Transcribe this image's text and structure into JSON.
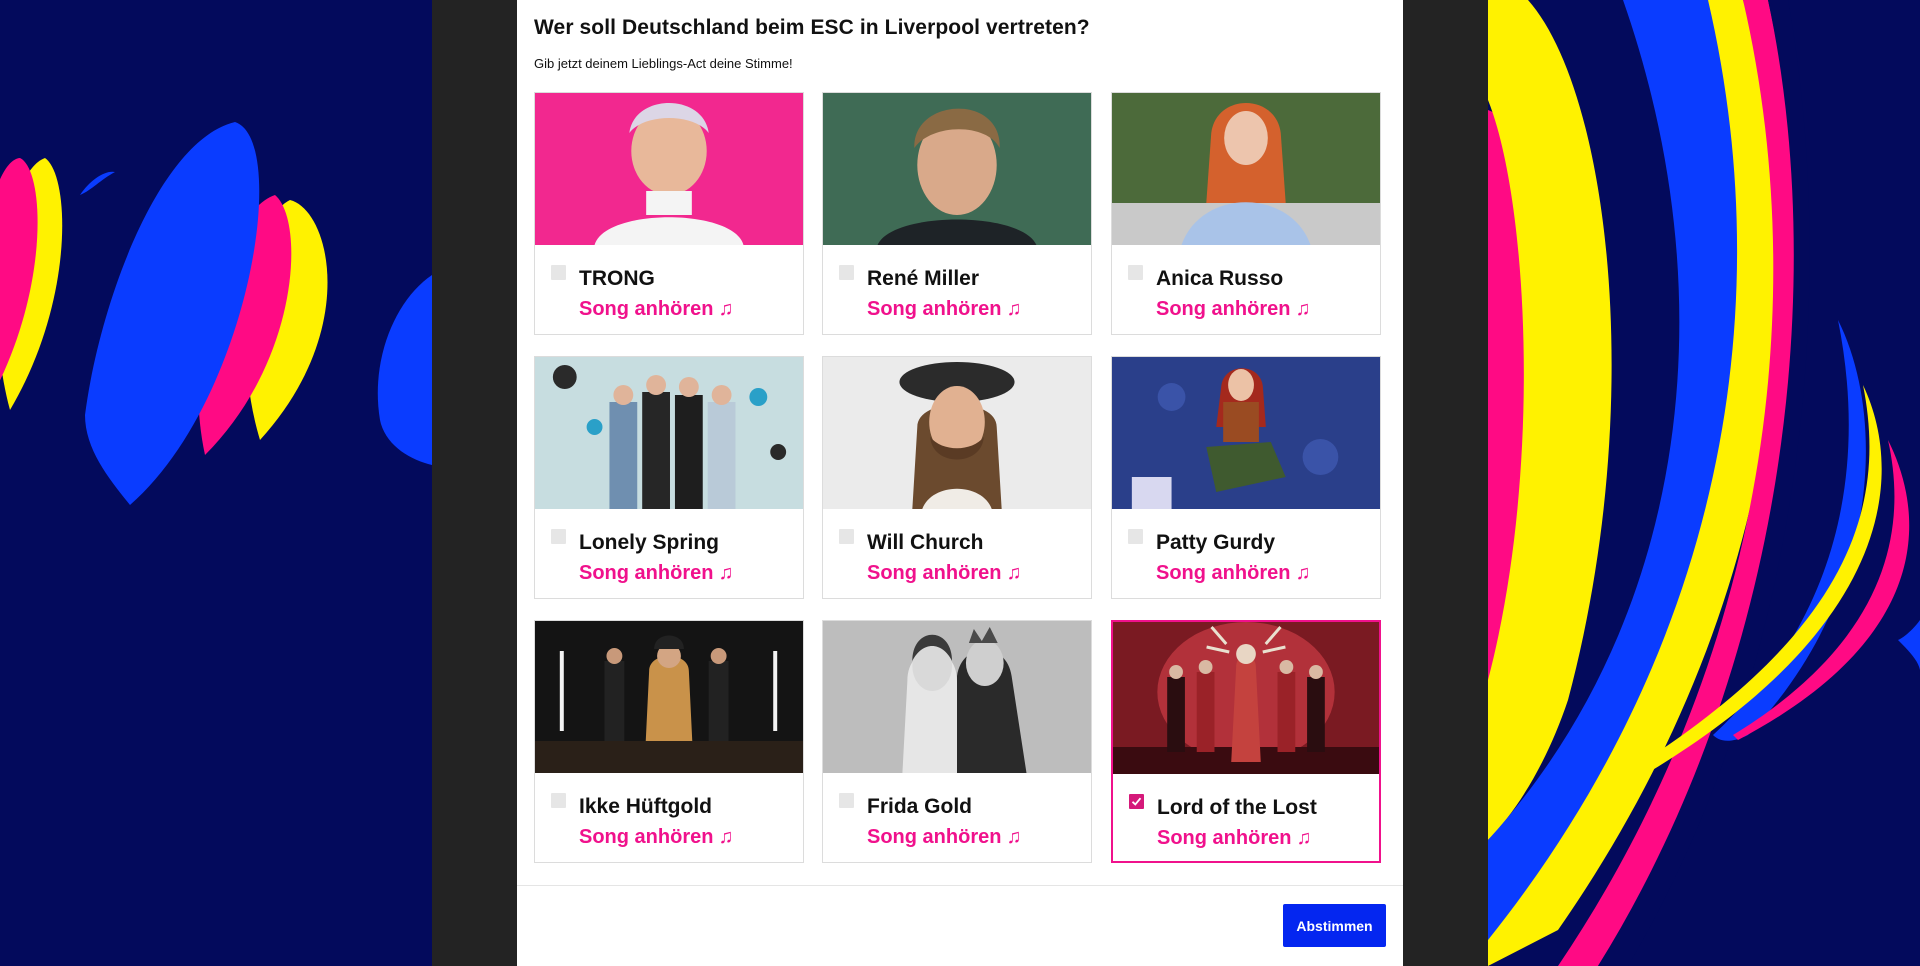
{
  "modal": {
    "title": "Wer soll Deutschland beim ESC in Liverpool vertreten?",
    "subtitle": "Gib jetzt deinem Lieblings-Act deine Stimme!",
    "vote_button": "Abstimmen"
  },
  "song_link_label": "Song anhören",
  "note_icon": "♫",
  "colors": {
    "background": "#030a5c",
    "accent_pink": "#f0118c",
    "vote_blue": "#0426f0",
    "yellow": "#fff200",
    "blue": "#0a3cff"
  },
  "acts": [
    {
      "name": "TRONG",
      "selected": false
    },
    {
      "name": "René Miller",
      "selected": false
    },
    {
      "name": "Anica Russo",
      "selected": false
    },
    {
      "name": "Lonely Spring",
      "selected": false
    },
    {
      "name": "Will Church",
      "selected": false
    },
    {
      "name": "Patty Gurdy",
      "selected": false
    },
    {
      "name": "Ikke Hüftgold",
      "selected": false
    },
    {
      "name": "Frida Gold",
      "selected": false
    },
    {
      "name": "Lord of the Lost",
      "selected": true
    }
  ]
}
